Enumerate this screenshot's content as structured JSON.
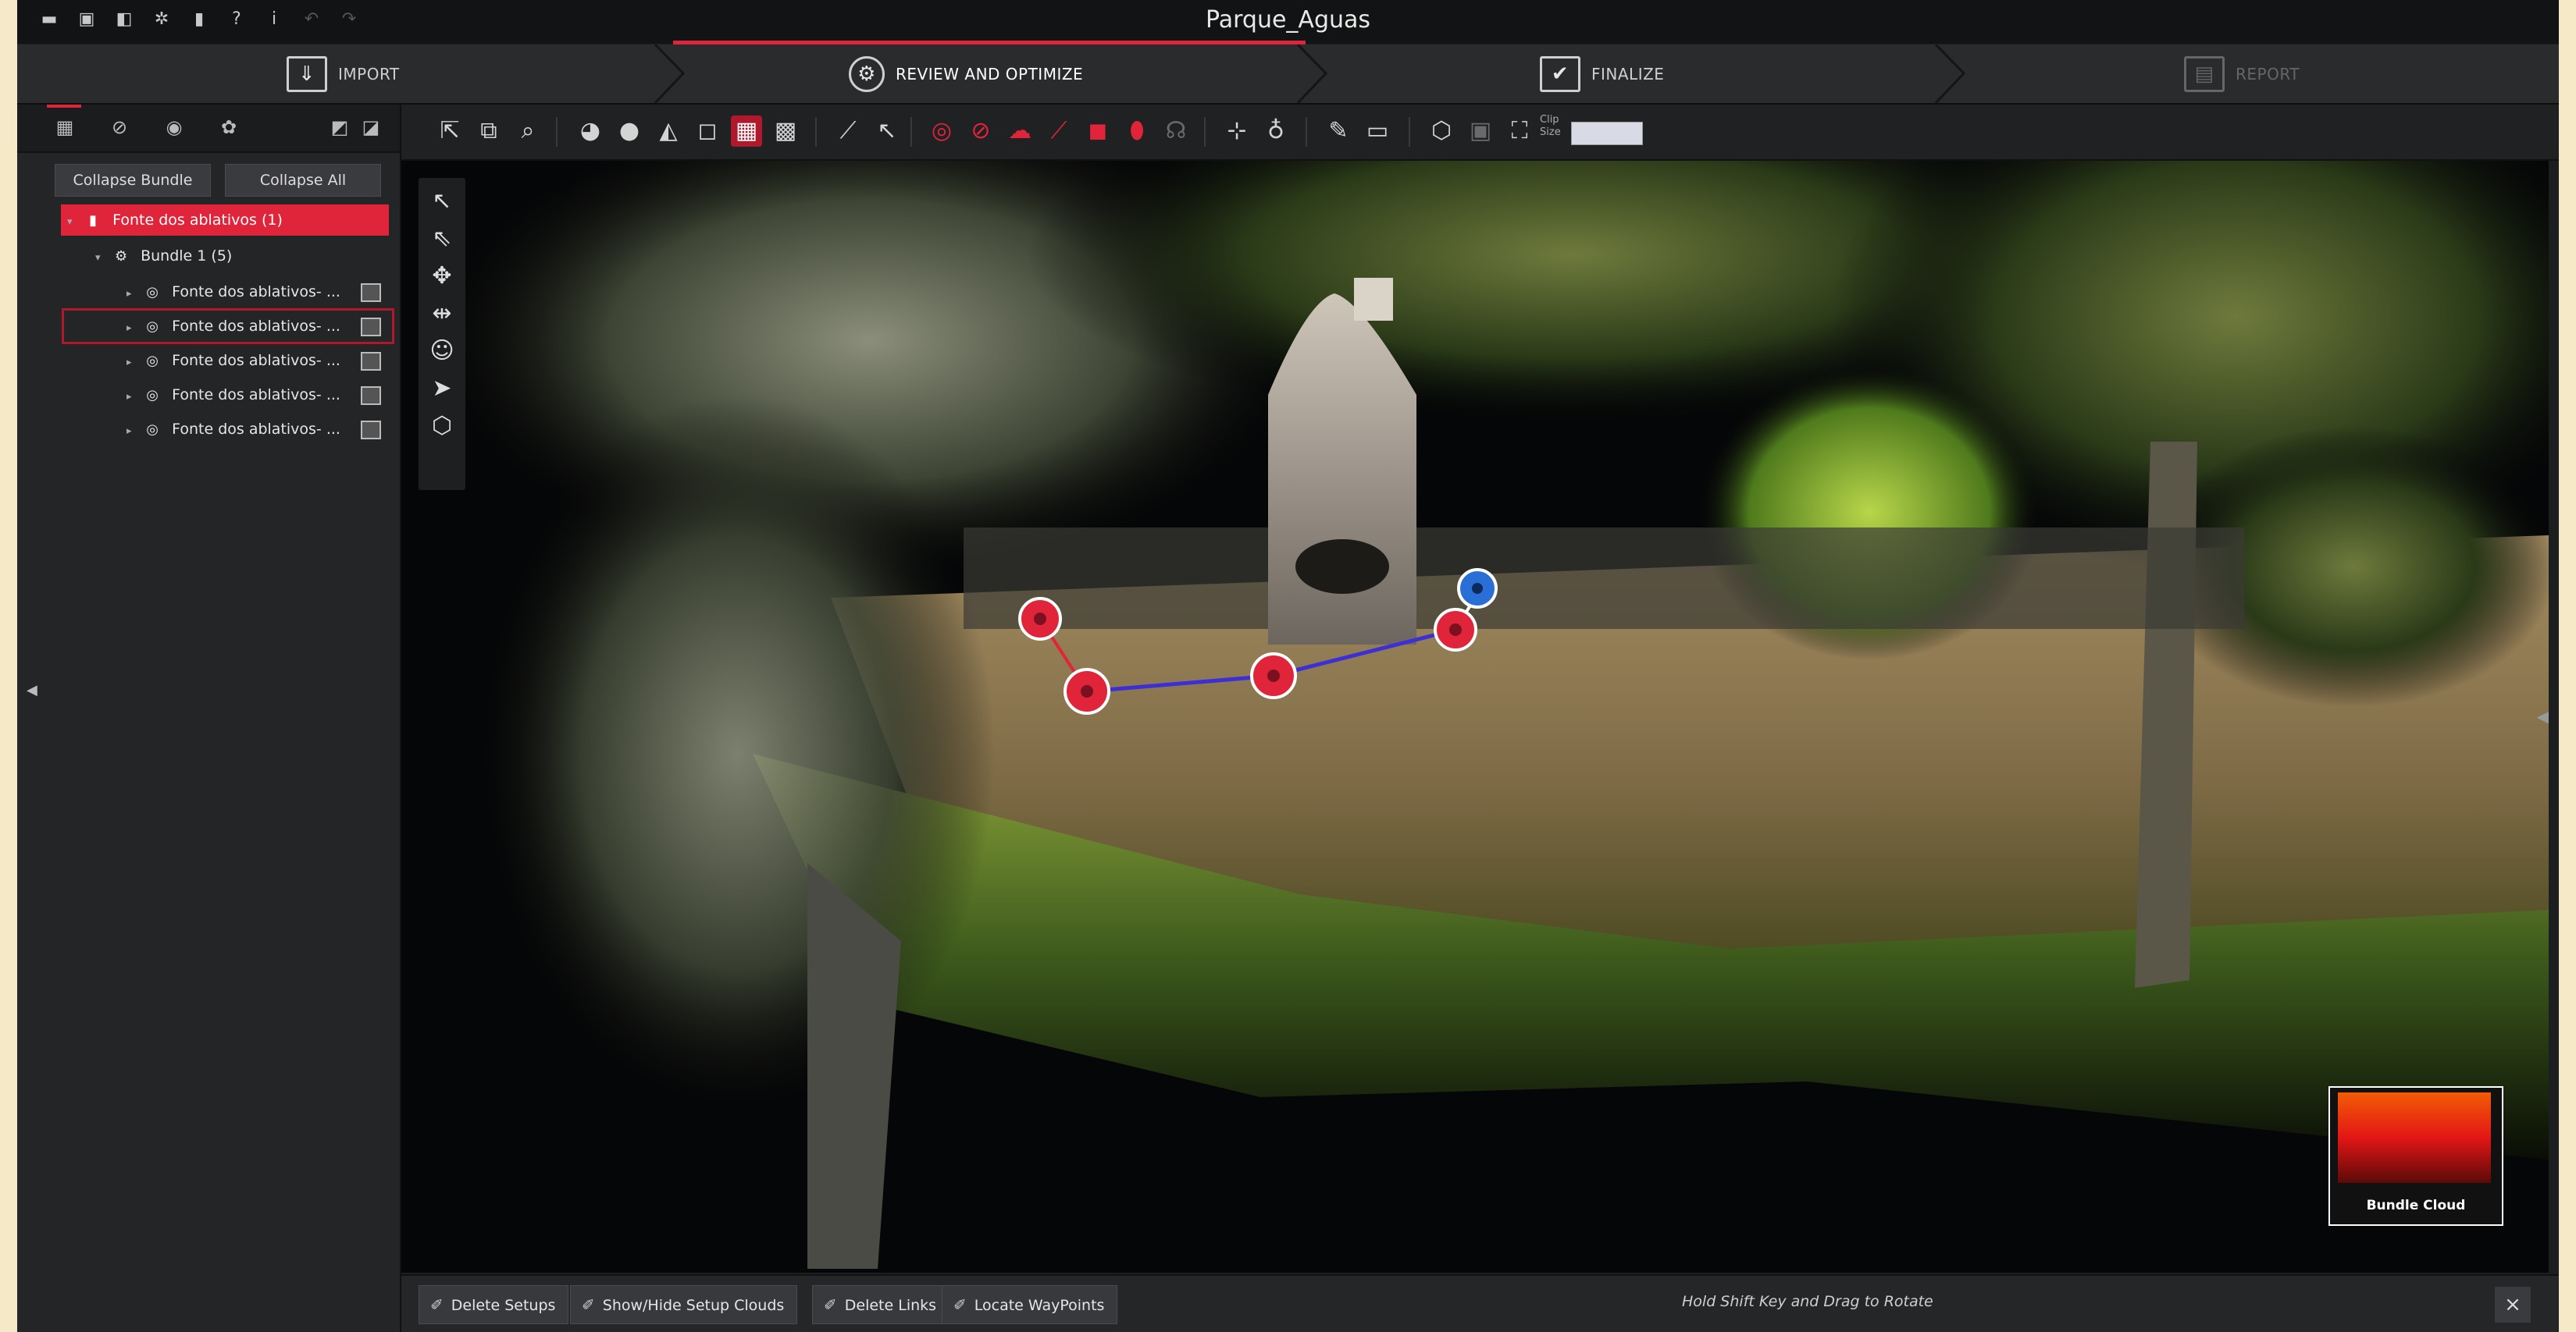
{
  "window": {
    "title": "Parque_Aguas"
  },
  "quick_access": [
    {
      "name": "open-folder-icon",
      "glyph": "▬"
    },
    {
      "name": "save-project-icon",
      "glyph": "▣"
    },
    {
      "name": "export-icon",
      "glyph": "◧"
    },
    {
      "name": "settings-gear-icon",
      "glyph": "✲"
    },
    {
      "name": "document-icon",
      "glyph": "▮"
    },
    {
      "name": "help-icon",
      "glyph": "?"
    },
    {
      "name": "info-icon",
      "glyph": "i"
    },
    {
      "name": "undo-icon",
      "glyph": "↶"
    },
    {
      "name": "redo-icon",
      "glyph": "↷"
    }
  ],
  "workflow": {
    "steps": [
      {
        "label": "IMPORT",
        "icon": "import-icon",
        "glyph": "⇓",
        "state": "done"
      },
      {
        "label": "REVIEW AND OPTIMIZE",
        "icon": "review-optimize-icon",
        "glyph": "⚙",
        "state": "active"
      },
      {
        "label": "FINALIZE",
        "icon": "finalize-check-icon",
        "glyph": "✔",
        "state": "done"
      },
      {
        "label": "REPORT",
        "icon": "report-icon",
        "glyph": "▤",
        "state": "disabled"
      }
    ]
  },
  "left_panel": {
    "tabs": [
      "project-tree-icon",
      "links-icon",
      "targets-icon",
      "settings-icon",
      "view-left-icon",
      "view-right-icon"
    ],
    "collapse_bundle": "Collapse Bundle",
    "collapse_all": "Collapse All",
    "tree": {
      "root": "Fonte dos ablativos (1)",
      "bundle": "Bundle 1 (5)",
      "setups": [
        "Fonte dos ablativos- ...",
        "Fonte dos ablativos- ...",
        "Fonte dos ablativos- ...",
        "Fonte dos ablativos- ...",
        "Fonte dos ablativos- ..."
      ],
      "selected_index": 1
    }
  },
  "toolbar": {
    "clip_size_label": "Clip\nSize",
    "clip_size_value": ""
  },
  "viewport": {
    "minimap_caption": "Bundle Cloud",
    "waypoints": 4,
    "colors": {
      "link": "#3d2fd6",
      "waypoint": "#e0243a",
      "active_setup": "#2a6fd6",
      "accent": "#e0243a"
    }
  },
  "bottom_bar": {
    "buttons": [
      "Delete Setups",
      "Show/Hide Setup Clouds",
      "Delete Links",
      "Locate WayPoints"
    ],
    "hint": "Hold Shift Key and Drag to Rotate",
    "close": "×"
  }
}
